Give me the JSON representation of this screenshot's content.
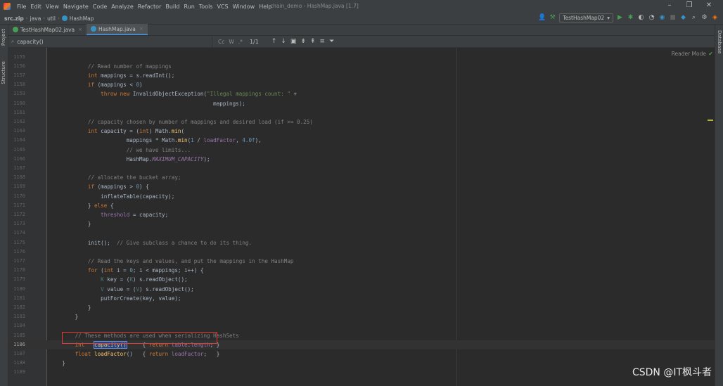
{
  "menu": [
    "File",
    "Edit",
    "View",
    "Navigate",
    "Code",
    "Analyze",
    "Refactor",
    "Build",
    "Run",
    "Tools",
    "VCS",
    "Window",
    "Help"
  ],
  "window_title": "chain_demo - HashMap.java [1.7]",
  "breadcrumbs": [
    "src.zip",
    "java",
    "util",
    "HashMap"
  ],
  "run_config": "TestHashMap02",
  "tabs": [
    {
      "label": "TestHashMap02.java",
      "active": false
    },
    {
      "label": "HashMap.java",
      "active": true
    }
  ],
  "find": {
    "query": "capacity()",
    "count": "1/1",
    "options": [
      "Cc",
      "W",
      ".*"
    ]
  },
  "side_tabs": {
    "project": "Project",
    "structure": "Structure",
    "database": "Database"
  },
  "reader_mode": "Reader Mode",
  "watermark": "CSDN @IT枫斗者",
  "editor": {
    "current_line": "1186",
    "lines": [
      {
        "num": "1155",
        "html": ""
      },
      {
        "num": "1156",
        "html": "            <span class='c'>// Read number of mappings</span>"
      },
      {
        "num": "1157",
        "html": "            <span class='k'>int</span> mappings = s.readInt();"
      },
      {
        "num": "1158",
        "html": "            <span class='k'>if</span> (mappings &lt; <span class='n'>0</span>)"
      },
      {
        "num": "1159",
        "html": "                <span class='k'>throw new</span> InvalidObjectException(<span class='s'>\"Illegal mappings count: \"</span> +"
      },
      {
        "num": "1160",
        "html": "                                                   mappings);"
      },
      {
        "num": "1161",
        "html": ""
      },
      {
        "num": "1162",
        "html": "            <span class='c'>// capacity chosen by number of mappings and desired load (if &gt;= 0.25)</span>"
      },
      {
        "num": "1163",
        "html": "            <span class='k'>int</span> capacity = (<span class='k'>int</span>) Math.<span class='m'>min</span>("
      },
      {
        "num": "1164",
        "html": "                        mappings * Math.<span class='m'>min</span>(<span class='n'>1</span> / <span class='f'>loadFactor</span>, <span class='n'>4.0f</span>),"
      },
      {
        "num": "1165",
        "html": "                        <span class='c'>// we have limits...</span>"
      },
      {
        "num": "1166",
        "html": "                        HashMap.<span class='fi'>MAXIMUM_CAPACITY</span>);"
      },
      {
        "num": "1167",
        "html": ""
      },
      {
        "num": "1168",
        "html": "            <span class='c'>// allocate the bucket array;</span>"
      },
      {
        "num": "1169",
        "html": "            <span class='k'>if</span> (mappings &gt; <span class='n'>0</span>) {"
      },
      {
        "num": "1170",
        "html": "                inflateTable(capacity);"
      },
      {
        "num": "1171",
        "html": "            } <span class='k'>else</span> {"
      },
      {
        "num": "1172",
        "html": "                <span class='f'>threshold</span> = capacity;"
      },
      {
        "num": "1173",
        "html": "            }"
      },
      {
        "num": "1174",
        "html": ""
      },
      {
        "num": "1175",
        "html": "            init();  <span class='c'>// Give subclass a chance to do its thing.</span>"
      },
      {
        "num": "1176",
        "html": ""
      },
      {
        "num": "1177",
        "html": "            <span class='c'>// Read the keys and values, and put the mappings in the HashMap</span>"
      },
      {
        "num": "1178",
        "html": "            <span class='k'>for</span> (<span class='k'>int</span> i = <span class='n'>0</span>; i &lt; mappings; i++) {"
      },
      {
        "num": "1179",
        "html": "                <span class='t'>K</span> key = (<span class='t'>K</span>) s.readObject();"
      },
      {
        "num": "1180",
        "html": "                <span class='t'>V</span> value = (<span class='t'>V</span>) s.readObject();"
      },
      {
        "num": "1181",
        "html": "                putForCreate(key, value);"
      },
      {
        "num": "1182",
        "html": "            }"
      },
      {
        "num": "1183",
        "html": "        }"
      },
      {
        "num": "1184",
        "html": ""
      },
      {
        "num": "1185",
        "html": "        <span class='c'>// These methods are used when serializing HashSets</span>"
      },
      {
        "num": "1186",
        "html": "        <span class='k'>int</span>   <span class='m sel'>capacity()</span>     { <span class='k'>return</span> <span class='f'>table</span>.<span class='f'>length</span>; }"
      },
      {
        "num": "1187",
        "html": "        <span class='k'>float</span> <span class='m'>loadFactor</span>()   { <span class='k'>return</span> <span class='f'>loadFactor</span>;   }"
      },
      {
        "num": "1188",
        "html": "    }"
      },
      {
        "num": "1189",
        "html": ""
      }
    ]
  },
  "colors": {
    "background": "#2b2b2b",
    "keyword": "#cc7832",
    "comment": "#808080",
    "number": "#6897bb",
    "string": "#6a8759",
    "field": "#9876aa",
    "method": "#ffc66d",
    "highlight_box": "#e53935"
  }
}
